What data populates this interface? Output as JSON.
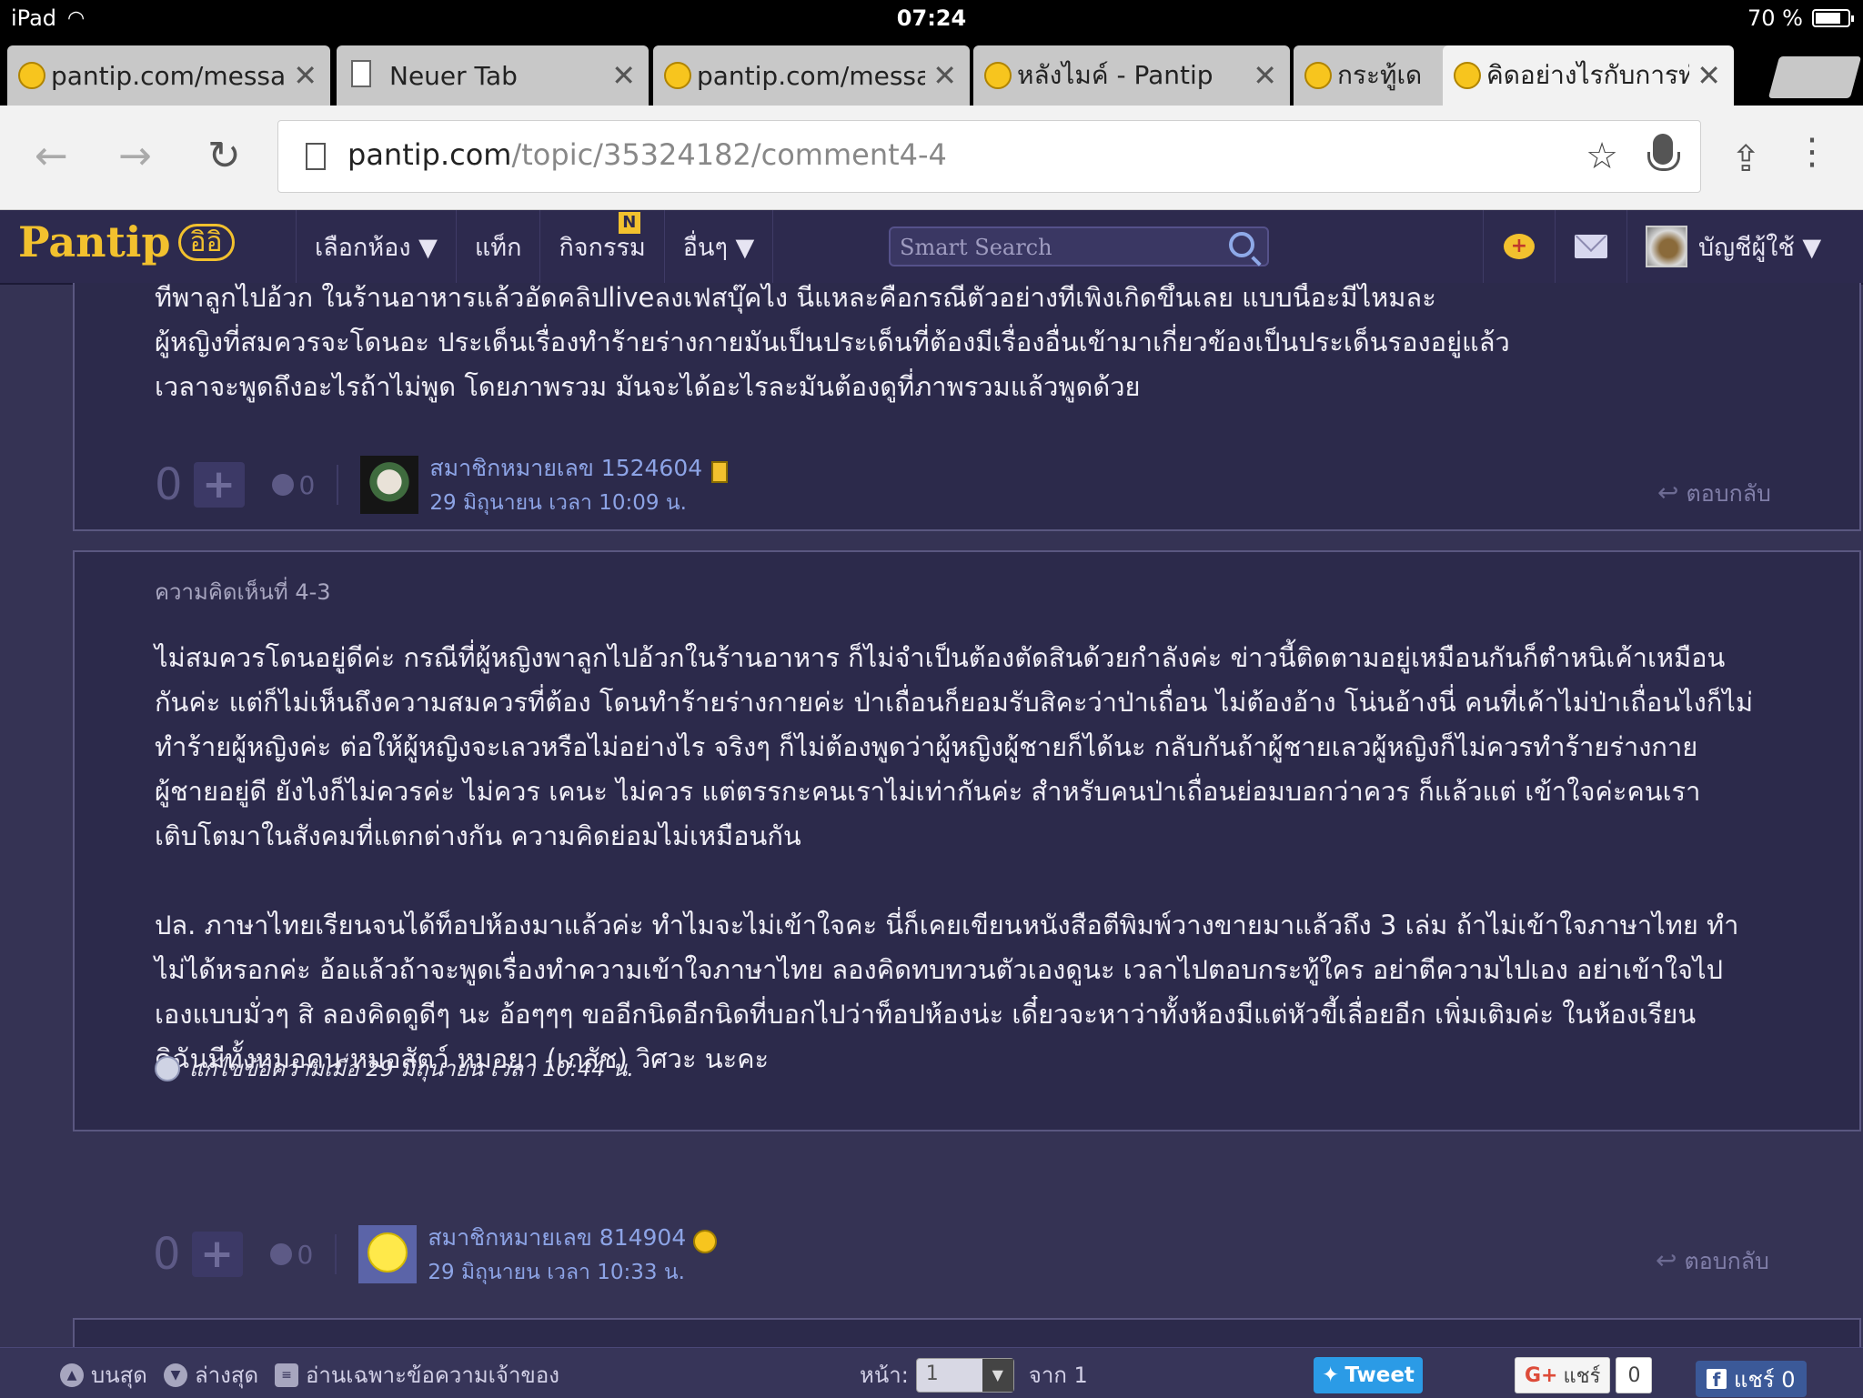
{
  "status_bar": {
    "device": "iPad",
    "time": "07:24",
    "battery": "70 %"
  },
  "tabs": [
    {
      "label": "pantip.com/messa",
      "active": false,
      "icon": "pantip-favicon"
    },
    {
      "label": "Neuer Tab",
      "active": false,
      "icon": "page-icon"
    },
    {
      "label": "pantip.com/messa",
      "active": false,
      "icon": "pantip-favicon"
    },
    {
      "label": "หลังไมค์ - Pantip",
      "active": false,
      "icon": "pantip-favicon"
    },
    {
      "label": "กระทู้เด",
      "active": false,
      "icon": "pantip-favicon"
    },
    {
      "label": "คิดอย่างไรกับการทำ",
      "active": true,
      "icon": "pantip-favicon"
    }
  ],
  "close_glyph": "✕",
  "address_bar": {
    "host": "pantip.com",
    "path": "/topic/35324182/comment4-4"
  },
  "site": {
    "logo": "Pantip",
    "logo_mark": "อิอิ",
    "nav": [
      "เลือกห้อง ▼",
      "แท็ก",
      "กิจกรรม",
      "อื่นๆ ▼"
    ],
    "activity_badge": "N",
    "search_placeholder": "Smart Search",
    "account_label": "บัญชีผู้ใช้ ▼"
  },
  "comments": [
    {
      "id": "prev",
      "text_lines": [
        "ที่พาลูกไปอ้วก ในร้านอาหารแล้วอัดคลิปliveลงเฟสบุ๊คไง นี่แหละคือกรณีตัวอย่างที่เพิ่งเกิดขึ้นเลย แบบนี้อะมีไหมละ",
        "ผู้หญิงที่สมควรจะโดนอะ ประเด็นเรื่องทำร้ายร่างกายมันเป็นประเด็นที่ต้องมีเรื่องอื่นเข้ามาเกี่ยวข้องเป็นประเด็นรองอยู่แล้ว",
        "เวลาจะพูดถึงอะไรถ้าไม่พูด โดยภาพรวม มันจะได้อะไรละมันต้องดูที่ภาพรวมแล้วพูดด้วย"
      ],
      "votes": "0",
      "emotions": "0",
      "member": "สมาชิกหมายเลข 1524604",
      "date": "29 มิถุนายน เวลา 10:09 น.",
      "reply": "ตอบกลับ"
    },
    {
      "id": "4-3",
      "number_label": "ความคิดเห็นที่ 4-3",
      "paragraphs": [
        [
          "ไม่สมควรโดนอยู่ดีค่ะ กรณีที่ผู้หญิงพาลูกไปอ้วกในร้านอาหาร ก็ไม่จำเป็นต้องตัดสินด้วยกำลังค่ะ ข่าวนี้ติดตามอยู่เหมือนกันก็ตำหนิเค้าเหมือน",
          "กันค่ะ แต่ก็ไม่เห็นถึงความสมควรที่ต้อง โดนทำร้ายร่างกายค่ะ ป่าเถื่อนก็ยอมรับสิคะว่าป่าเถื่อน ไม่ต้องอ้าง โน่นอ้างนี่ คนที่เค้าไม่ป่าเถื่อนไงก็ไม่",
          "ทำร้ายผู้หญิงค่ะ ต่อให้ผู้หญิงจะเลวหรือไม่อย่างไร จริงๆ ก็ไม่ต้องพูดว่าผู้หญิงผู้ชายก็ได้นะ กลับกันถ้าผู้ชายเลวผู้หญิงก็ไม่ควรทำร้ายร่างกาย",
          "ผู้ชายอยู่ดี ยังไงก็ไม่ควรค่ะ ไม่ควร เคนะ ไม่ควร แต่ตรรกะคนเราไม่เท่ากันค่ะ สำหรับคนป่าเถื่อนย่อมบอกว่าควร ก็แล้วแต่ เข้าใจค่ะคนเรา",
          "เติบโตมาในสังคมที่แตกต่างกัน ความคิดย่อมไม่เหมือนกัน"
        ],
        [
          "ปล. ภาษาไทยเรียนจนได้ท็อปห้องมาแล้วค่ะ ทำไมจะไม่เข้าใจคะ นี่ก็เคยเขียนหนังสือตีพิมพ์วางขายมาแล้วถึง 3 เล่ม ถ้าไม่เข้าใจภาษาไทย ทำ",
          "ไม่ได้หรอกค่ะ อ้อแล้วถ้าจะพูดเรื่องทำความเข้าใจภาษาไทย ลองคิดทบทวนตัวเองดูนะ เวลาไปตอบกระทู้ใคร อย่าตีความไปเอง อย่าเข้าใจไป",
          "เองแบบมั่วๆ สิ ลองคิดดูดีๆ นะ อ้อๆๆๆ ขออีกนิดอีกนิดที่บอกไปว่าท็อปห้องน่ะ เดี๋ยวจะหาว่าทั้งห้องมีแต่หัวขี้เลื่อยอีก เพิ่มเติมค่ะ ในห้องเรียน",
          "ดิฉันมีทั้งหมอคน หมอสัตว์ หมอยา (เภสัช) วิศวะ นะคะ"
        ]
      ],
      "edit_note": "แก้ไขข้อความเมื่อ 29 มิถุนายน เวลา 10:44 น.",
      "votes": "0",
      "emotions": "0",
      "member": "สมาชิกหมายเลข 814904",
      "date": "29 มิถุนายน เวลา 10:33 น.",
      "reply": "ตอบกลับ"
    }
  ],
  "bottom_bar": {
    "top_label": "บนสุด",
    "bottom_label": "ล่างสุด",
    "owner_only_label": "อ่านเฉพาะข้อความเจ้าของ",
    "page_label": "หน้า:",
    "page_value": "1",
    "of_label": "จาก 1",
    "tweet_label": "Tweet",
    "gplus_label": "แชร์",
    "gplus_count": "0",
    "fb_label": "แชร์ 0"
  }
}
